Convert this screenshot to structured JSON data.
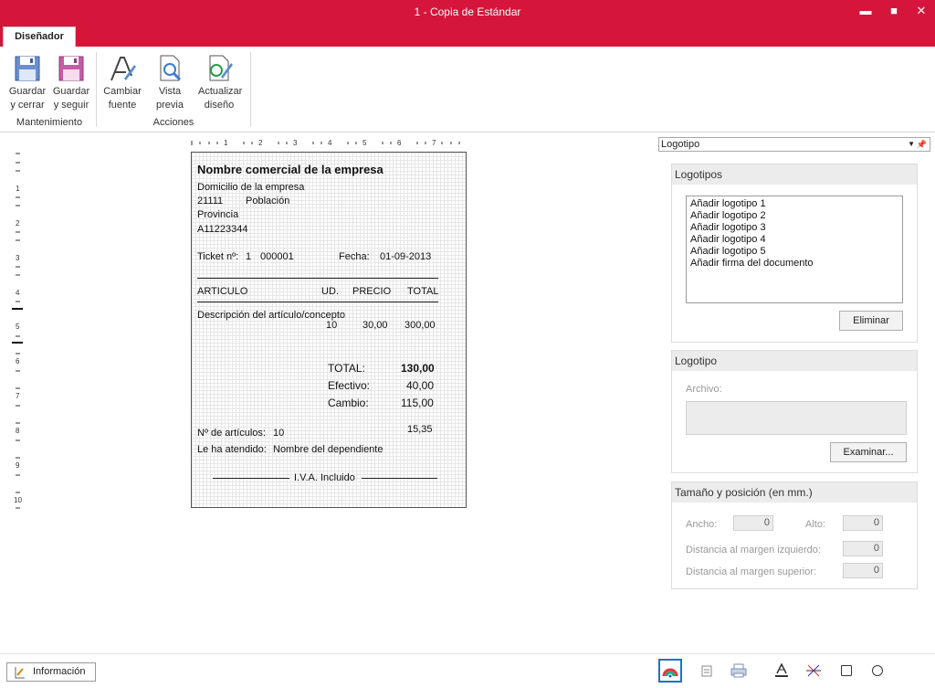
{
  "window": {
    "title": "1 - Copia de Estándar",
    "minimize": "▬",
    "maximize": "■",
    "close": "✕"
  },
  "ribbon": {
    "tab": "Diseñador",
    "groups": [
      {
        "label": "Mantenimiento",
        "buttons": [
          "Guardar\ny cerrar",
          "Guardar\ny seguir"
        ]
      },
      {
        "label": "Acciones",
        "buttons": [
          "Cambiar\nfuente",
          "Vista\nprevia",
          "Actualizar\ndiseño"
        ]
      }
    ]
  },
  "rulers": {
    "h_numbers": [
      "1",
      "2",
      "3",
      "4",
      "5",
      "6",
      "7"
    ],
    "v_numbers": [
      "1",
      "2",
      "3",
      "4",
      "5",
      "6",
      "7",
      "8",
      "9",
      "10"
    ]
  },
  "ticket": {
    "company": "Nombre  comercial de la empresa",
    "address": "Domicilio de la empresa",
    "postal_code": "21111",
    "city": "Población",
    "province": "Provincia",
    "tax_id": "A11223344",
    "ticket_label": "Ticket nº:",
    "ticket_series": "1",
    "ticket_number": "000001",
    "date_label": "Fecha:",
    "date": "01-09-2013",
    "col_article": "ARTICULO",
    "col_units": "UD.",
    "col_price": "PRECIO",
    "col_total": "TOTAL",
    "item_desc": "Descripción del artículo/concepto",
    "item_units": "10",
    "item_price": "30,00",
    "item_total": "300,00",
    "total_label": "TOTAL:",
    "total_value": "130,00",
    "cash_label": "Efectivo:",
    "cash_value": "40,00",
    "change_label": "Cambio:",
    "change_value": "115,00",
    "extra_value": "15,35",
    "articles_label": "Nº de artículos:",
    "articles_value": "10",
    "attended_label": "Le ha atendido:",
    "attended_value": "Nombre del dependiente",
    "vat_text": "I.V.A. Incluido"
  },
  "panel": {
    "selector": "Logotipo",
    "logos_header": "Logotipos",
    "logos": [
      "Añadir logotipo 1",
      "Añadir logotipo 2",
      "Añadir logotipo 3",
      "Añadir logotipo 4",
      "Añadir logotipo 5",
      "Añadir firma del documento"
    ],
    "delete_button": "Eliminar",
    "logo_header": "Logotipo",
    "file_label": "Archivo:",
    "browse_button": "Examinar...",
    "size_header": "Tamaño y posición (en mm.)",
    "width_label": "Ancho:",
    "width_value": "0",
    "height_label": "Alto:",
    "height_value": "0",
    "left_margin_label": "Distancia al margen izquierdo:",
    "left_margin_value": "0",
    "top_margin_label": "Distancia al margen superior:",
    "top_margin_value": "0"
  },
  "statusbar": {
    "info_button": "Información"
  },
  "colors": {
    "accent": "#d6153a"
  }
}
